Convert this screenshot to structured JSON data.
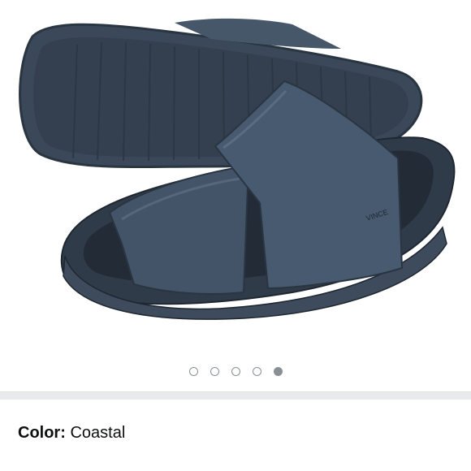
{
  "product": {
    "image_alt": "Navy two-band slide sandals",
    "brand_mark": "VINCE",
    "colors": {
      "sandal": "#3b4a5c",
      "sandal_dark": "#27323f",
      "background": "#ffffff"
    }
  },
  "carousel": {
    "dot_count": 5,
    "active_index": 4
  },
  "variation": {
    "label": "Color:",
    "value": "Coastal"
  }
}
